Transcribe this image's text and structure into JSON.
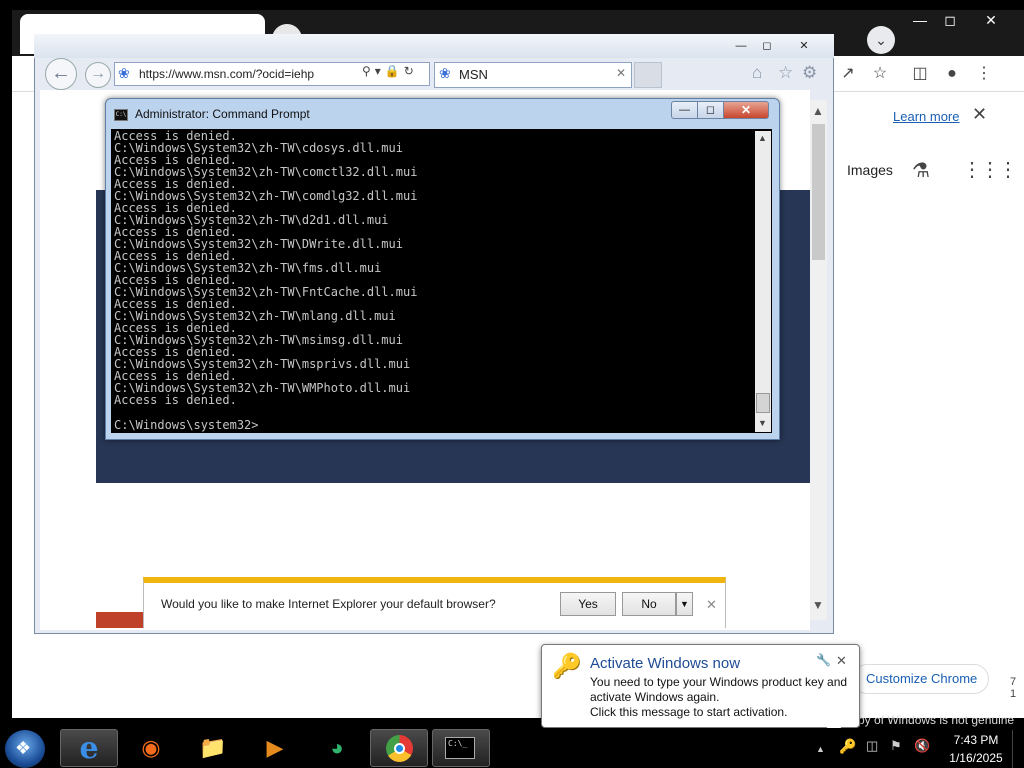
{
  "chrome": {
    "learn_more": "Learn more",
    "images_label": "Images",
    "customize_label": "Customize Chrome",
    "not_genuine": "py of Windows is not genuine",
    "side_chars": "7\n1"
  },
  "ie": {
    "address_url": "https://www.msn.com/?ocid=iehp",
    "tab_label": "MSN",
    "default_prompt": "Would you like to make Internet Explorer your default browser?",
    "yes_label": "Yes",
    "no_label": "No"
  },
  "cmd": {
    "title": "Administrator: Command Prompt",
    "lines": [
      "Access is denied.",
      "C:\\Windows\\System32\\zh-TW\\cdosys.dll.mui",
      "Access is denied.",
      "C:\\Windows\\System32\\zh-TW\\comctl32.dll.mui",
      "Access is denied.",
      "C:\\Windows\\System32\\zh-TW\\comdlg32.dll.mui",
      "Access is denied.",
      "C:\\Windows\\System32\\zh-TW\\d2d1.dll.mui",
      "Access is denied.",
      "C:\\Windows\\System32\\zh-TW\\DWrite.dll.mui",
      "Access is denied.",
      "C:\\Windows\\System32\\zh-TW\\fms.dll.mui",
      "Access is denied.",
      "C:\\Windows\\System32\\zh-TW\\FntCache.dll.mui",
      "Access is denied.",
      "C:\\Windows\\System32\\zh-TW\\mlang.dll.mui",
      "Access is denied.",
      "C:\\Windows\\System32\\zh-TW\\msimsg.dll.mui",
      "Access is denied.",
      "C:\\Windows\\System32\\zh-TW\\msprivs.dll.mui",
      "Access is denied.",
      "C:\\Windows\\System32\\zh-TW\\WMPhoto.dll.mui",
      "Access is denied."
    ],
    "prompt": "C:\\Windows\\system32>"
  },
  "balloon": {
    "title": "Activate Windows now",
    "line1": "You need to type your Windows product key and",
    "line2": "activate Windows again.",
    "line3": "Click this message to start activation."
  },
  "taskbar": {
    "time": "7:43 PM",
    "date": "1/16/2025",
    "icons": [
      "windows-start-icon",
      "internet-explorer-icon",
      "firefox-icon",
      "file-explorer-icon",
      "media-player-icon",
      "edge-icon",
      "chrome-icon",
      "command-prompt-icon"
    ]
  },
  "colors": {
    "banner": "#273655",
    "notif_accent": "#f1b50f",
    "balloon_title": "#1e4c96"
  }
}
